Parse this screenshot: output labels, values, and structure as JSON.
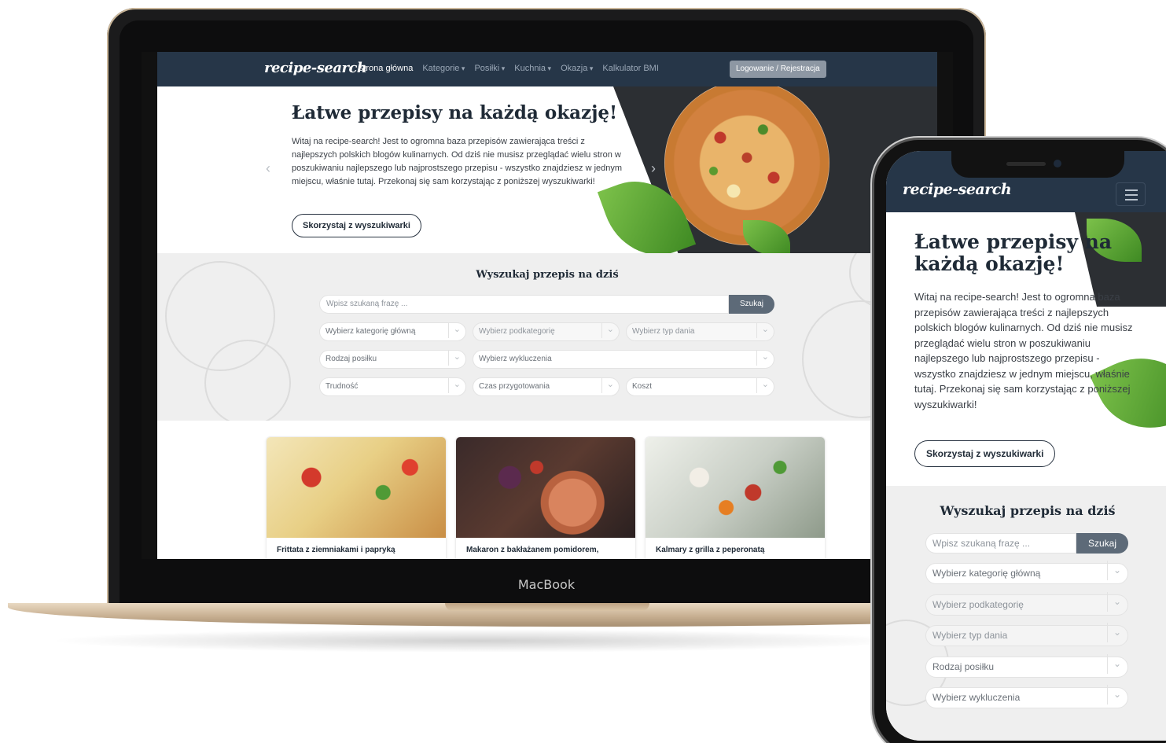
{
  "laptop": {
    "bezel_label": "MacBook",
    "nav": {
      "logo": "recipe-search",
      "links": [
        "Strona główna",
        "Kategorie",
        "Posiłki",
        "Kuchnia",
        "Okazja",
        "Kalkulator BMI"
      ],
      "login": "Logowanie / Rejestracja"
    },
    "hero": {
      "title": "Łatwe przepisy na każdą okazję!",
      "text": "Witaj na recipe-search! Jest to ogromna baza przepisów zawierająca treści z najlepszych polskich blogów kulinarnych. Od dziś nie musisz przeglądać wielu stron w poszukiwaniu najlepszego lub najprostszego przepisu - wszystko znajdziesz w jednym miejscu, właśnie tutaj. Przekonaj się sam korzystając z poniższej wyszukiwarki!",
      "button": "Skorzystaj z wyszukiwarki",
      "prev": "‹",
      "next": "›"
    },
    "search": {
      "title": "Wyszukaj przepis na dziś",
      "placeholder": "Wpisz szukaną frazę ...",
      "button": "Szukaj",
      "selects": {
        "main_category": "Wybierz kategorię główną",
        "subcategory": "Wybierz podkategorię",
        "dish_type": "Wybierz typ dania",
        "meal_type": "Rodzaj posiłku",
        "exclusions": "Wybierz wykluczenia",
        "difficulty": "Trudność",
        "prep_time": "Czas przygotowania",
        "cost": "Koszt"
      }
    },
    "cards": [
      {
        "title": "Frittata z ziemniakami i papryką"
      },
      {
        "title": "Makaron z bakłażanem pomidorem,"
      },
      {
        "title": "Kalmary z grilla z peperonatą"
      }
    ]
  },
  "phone": {
    "nav": {
      "logo": "recipe-search"
    },
    "hero": {
      "title": "Łatwe przepisy na każdą okazję!",
      "text": "Witaj na recipe-search! Jest to ogromna baza przepisów zawierająca treści z najlepszych polskich blogów kulinarnych. Od dziś nie musisz przeglądać wielu stron w poszukiwaniu najlepszego lub najprostszego przepisu - wszystko znajdziesz w jednym miejscu, właśnie tutaj. Przekonaj się sam korzystając z poniższej wyszukiwarki!",
      "button": "Skorzystaj z wyszukiwarki"
    },
    "search": {
      "title": "Wyszukaj przepis na dziś",
      "placeholder": "Wpisz szukaną frazę ...",
      "button": "Szukaj",
      "selects": [
        "Wybierz kategorię główną",
        "Wybierz podkategorię",
        "Wybierz typ dania",
        "Rodzaj posiłku",
        "Wybierz wykluczenia"
      ]
    }
  },
  "colors": {
    "nav_bg": "#263648",
    "search_button": "#5d6a78",
    "login_button": "#8d97a3",
    "section_bg": "#efefef"
  },
  "icons": [
    "chevron-left-icon",
    "chevron-right-icon",
    "dropdown-chevron-icon",
    "hamburger-menu-icon"
  ]
}
